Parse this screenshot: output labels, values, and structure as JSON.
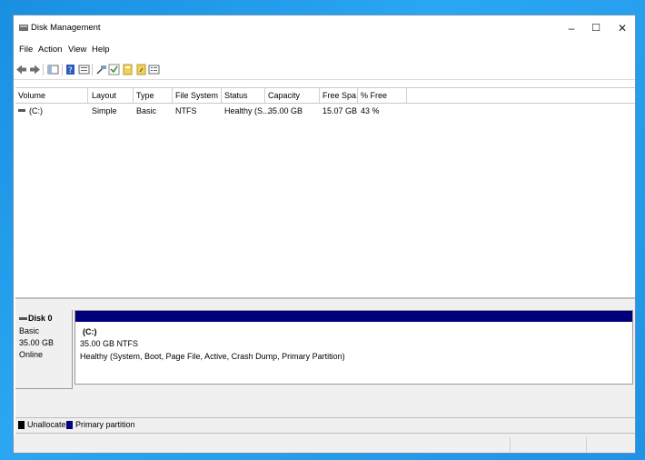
{
  "window": {
    "title": "Disk Management",
    "controls": {
      "minimize": "–",
      "maximize": "☐",
      "close": "✕"
    }
  },
  "menu": [
    "File",
    "Action",
    "View",
    "Help"
  ],
  "toolbar": {
    "icons": [
      "back-icon",
      "forward-icon",
      "console-tree-icon",
      "properties-icon",
      "help-icon",
      "refresh-icon",
      "connect-icon",
      "check-icon",
      "new-volume-icon",
      "export-icon",
      "list-view-icon"
    ]
  },
  "volume_list": {
    "columns": [
      "Volume",
      "Layout",
      "Type",
      "File System",
      "Status",
      "Capacity",
      "Free Spa...",
      "% Free"
    ],
    "rows": [
      {
        "volume": "(C:)",
        "layout": "Simple",
        "type": "Basic",
        "fs": "NTFS",
        "status": "Healthy (S...",
        "capacity": "35.00 GB",
        "free": "15.07 GB",
        "pct": "43 %"
      }
    ]
  },
  "disk": {
    "name": "Disk 0",
    "type": "Basic",
    "size": "35.00 GB",
    "state": "Online",
    "partition": {
      "label": "(C:)",
      "size_fs": "35.00 GB NTFS",
      "status": "Healthy (System, Boot, Page File, Active, Crash Dump, Primary Partition)",
      "bar_color": "#00007d"
    }
  },
  "legend": [
    {
      "label": "Unallocated",
      "color": "#000000"
    },
    {
      "label": "Primary partition",
      "color": "#00007d"
    }
  ]
}
